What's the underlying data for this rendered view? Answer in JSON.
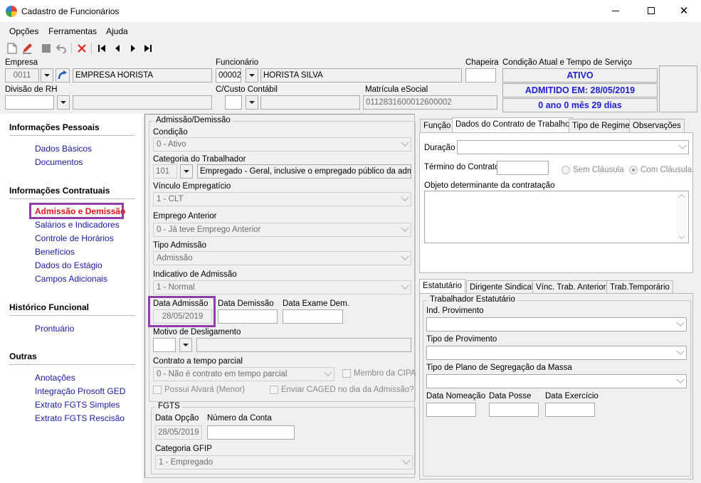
{
  "window": {
    "title": "Cadastro de Funcionários",
    "min": "—",
    "max": "☐",
    "close": "✕"
  },
  "menu": [
    "Opções",
    "Ferramentas",
    "Ajuda"
  ],
  "header": {
    "empresa_label": "Empresa",
    "empresa_code": "0011",
    "empresa_name": "EMPRESA HORISTA",
    "funcionario_label": "Funcionário",
    "funcionario_code": "00002",
    "funcionario_name": "HORISTA SILVA",
    "chapeira_label": "Chapeira",
    "chapeira_value": "",
    "condicao_label": "Condição Atual e Tempo de Serviço",
    "status": "ATIVO",
    "admitido": "ADMITIDO EM: 28/05/2019",
    "tempo": "0 ano 0 mês 29 dias",
    "divisao_label": "Divisão de RH",
    "divisao_code": "",
    "divisao_name": "",
    "ccusto_label": "C/Custo Contábil",
    "ccusto_code": "",
    "ccusto_name": "",
    "matricula_label": "Matrícula eSocial",
    "matricula_value": "0112831600012600002"
  },
  "sidebar": {
    "sections": [
      {
        "title": "Informações Pessoais",
        "items": [
          "Dados Básicos",
          "Documentos"
        ]
      },
      {
        "title": "Informações Contratuais",
        "items": [
          "Admissão e Demissão",
          "Salários e Indicadores",
          "Controle de Horários",
          "Benefícios",
          "Dados do Estágio",
          "Campos Adicionais"
        ]
      },
      {
        "title": "Histórico Funcional",
        "items": [
          "Prontuário"
        ]
      },
      {
        "title": "Outras",
        "items": [
          "Anotações",
          "Integração Prosoft GED",
          "Extrato FGTS Simples",
          "Extrato FGTS Rescisão"
        ]
      }
    ],
    "active": "Admissão e Demissão"
  },
  "admissao": {
    "group": "Admissão/Demissão",
    "condicao_label": "Condição",
    "condicao_value": "0 - Ativo",
    "categoria_label": "Categoria do Trabalhador",
    "categoria_code": "101",
    "categoria_desc": "Empregado - Geral, inclusive o empregado público da administ",
    "vinculo_label": "Vínculo Empregatício",
    "vinculo_value": "1 - CLT",
    "emprego_label": "Emprego Anterior",
    "emprego_value": "0 - Já teve Emprego Anterior",
    "tipo_label": "Tipo Admissão",
    "tipo_value": "Admissão",
    "indicativo_label": "Indicativo de Admissão",
    "indicativo_value": "1 - Normal",
    "data_adm_label": "Data Admissão",
    "data_adm_value": "28/05/2019",
    "data_dem_label": "Data Demissão",
    "data_dem_value": "",
    "data_exame_label": "Data Exame Dem.",
    "data_exame_value": "",
    "motivo_label": "Motivo de Desligamento",
    "parcial_label": "Contrato a tempo parcial",
    "parcial_value": "0 - Não é contrato em tempo parcial",
    "cipa_label": "Membro da CIPA",
    "alvara_label": "Possui Alvará (Menor)",
    "caged_label": "Enviar CAGED no dia da Admissão?"
  },
  "fgts": {
    "group": "FGTS",
    "opcao_label": "Data Opção",
    "opcao_value": "28/05/2019",
    "conta_label": "Número da Conta",
    "conta_value": "",
    "gfip_label": "Categoria GFIP",
    "gfip_value": "1 - Empregado"
  },
  "tabs_top": [
    "Função",
    "Dados do Contrato de Trabalho",
    "Tipo de Regime",
    "Observações"
  ],
  "contrato": {
    "duracao_label": "Duração",
    "termino_label": "Término do Contrato",
    "sem_clausula": "Sem Cláusula",
    "com_clausula": "Com Cláusula",
    "objeto_label": "Objeto determinante da contratação"
  },
  "tabs_bottom": [
    "Estatutário",
    "Dirigente Sindical",
    "Vínc. Trab. Anterior",
    "Trab.Temporário"
  ],
  "estatutario": {
    "group": "Trabalhador Estatutário",
    "ind_label": "Ind. Provimento",
    "tipo_label": "Tipo de Provimento",
    "plano_label": "Tipo de Plano de Segregação da Massa",
    "nomeacao_label": "Data Nomeação",
    "posse_label": "Data Posse",
    "exercicio_label": "Data Exercício"
  },
  "colors": {
    "accent_border": "#8e3fa8",
    "status_blue": "#1f1fd6",
    "link": "#1a1aa6",
    "active_link": "#e0141c"
  }
}
